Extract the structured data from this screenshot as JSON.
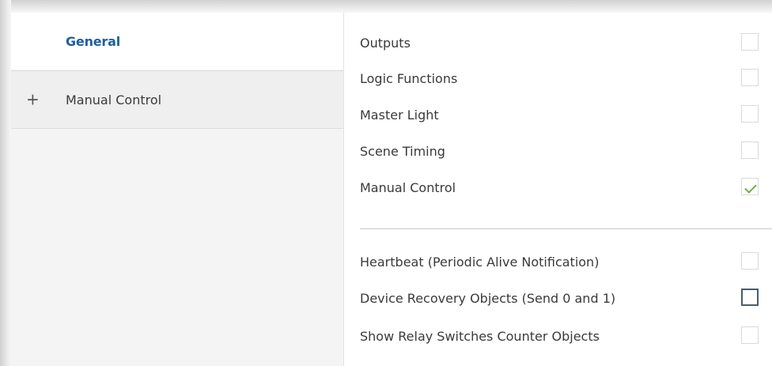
{
  "sidebar": {
    "items": [
      {
        "label": "General",
        "active": true
      },
      {
        "label": "Manual Control",
        "expander": "+"
      }
    ]
  },
  "main": {
    "section1": [
      {
        "label": "Outputs",
        "checked": false
      },
      {
        "label": "Logic Functions",
        "checked": false
      },
      {
        "label": "Master Light",
        "checked": false
      },
      {
        "label": "Scene Timing",
        "checked": false
      },
      {
        "label": "Manual Control",
        "checked": true
      }
    ],
    "section2": [
      {
        "label": "Heartbeat (Periodic Alive Notification)",
        "checked": false
      },
      {
        "label": "Device Recovery Objects (Send 0 and 1)",
        "checked": false,
        "focused": true
      },
      {
        "label": "Show Relay Switches Counter Objects",
        "checked": false
      }
    ]
  },
  "colors": {
    "active_text": "#1f5f9c",
    "check": "#6ab04c",
    "sidebar_bg": "#f4f4f4"
  }
}
